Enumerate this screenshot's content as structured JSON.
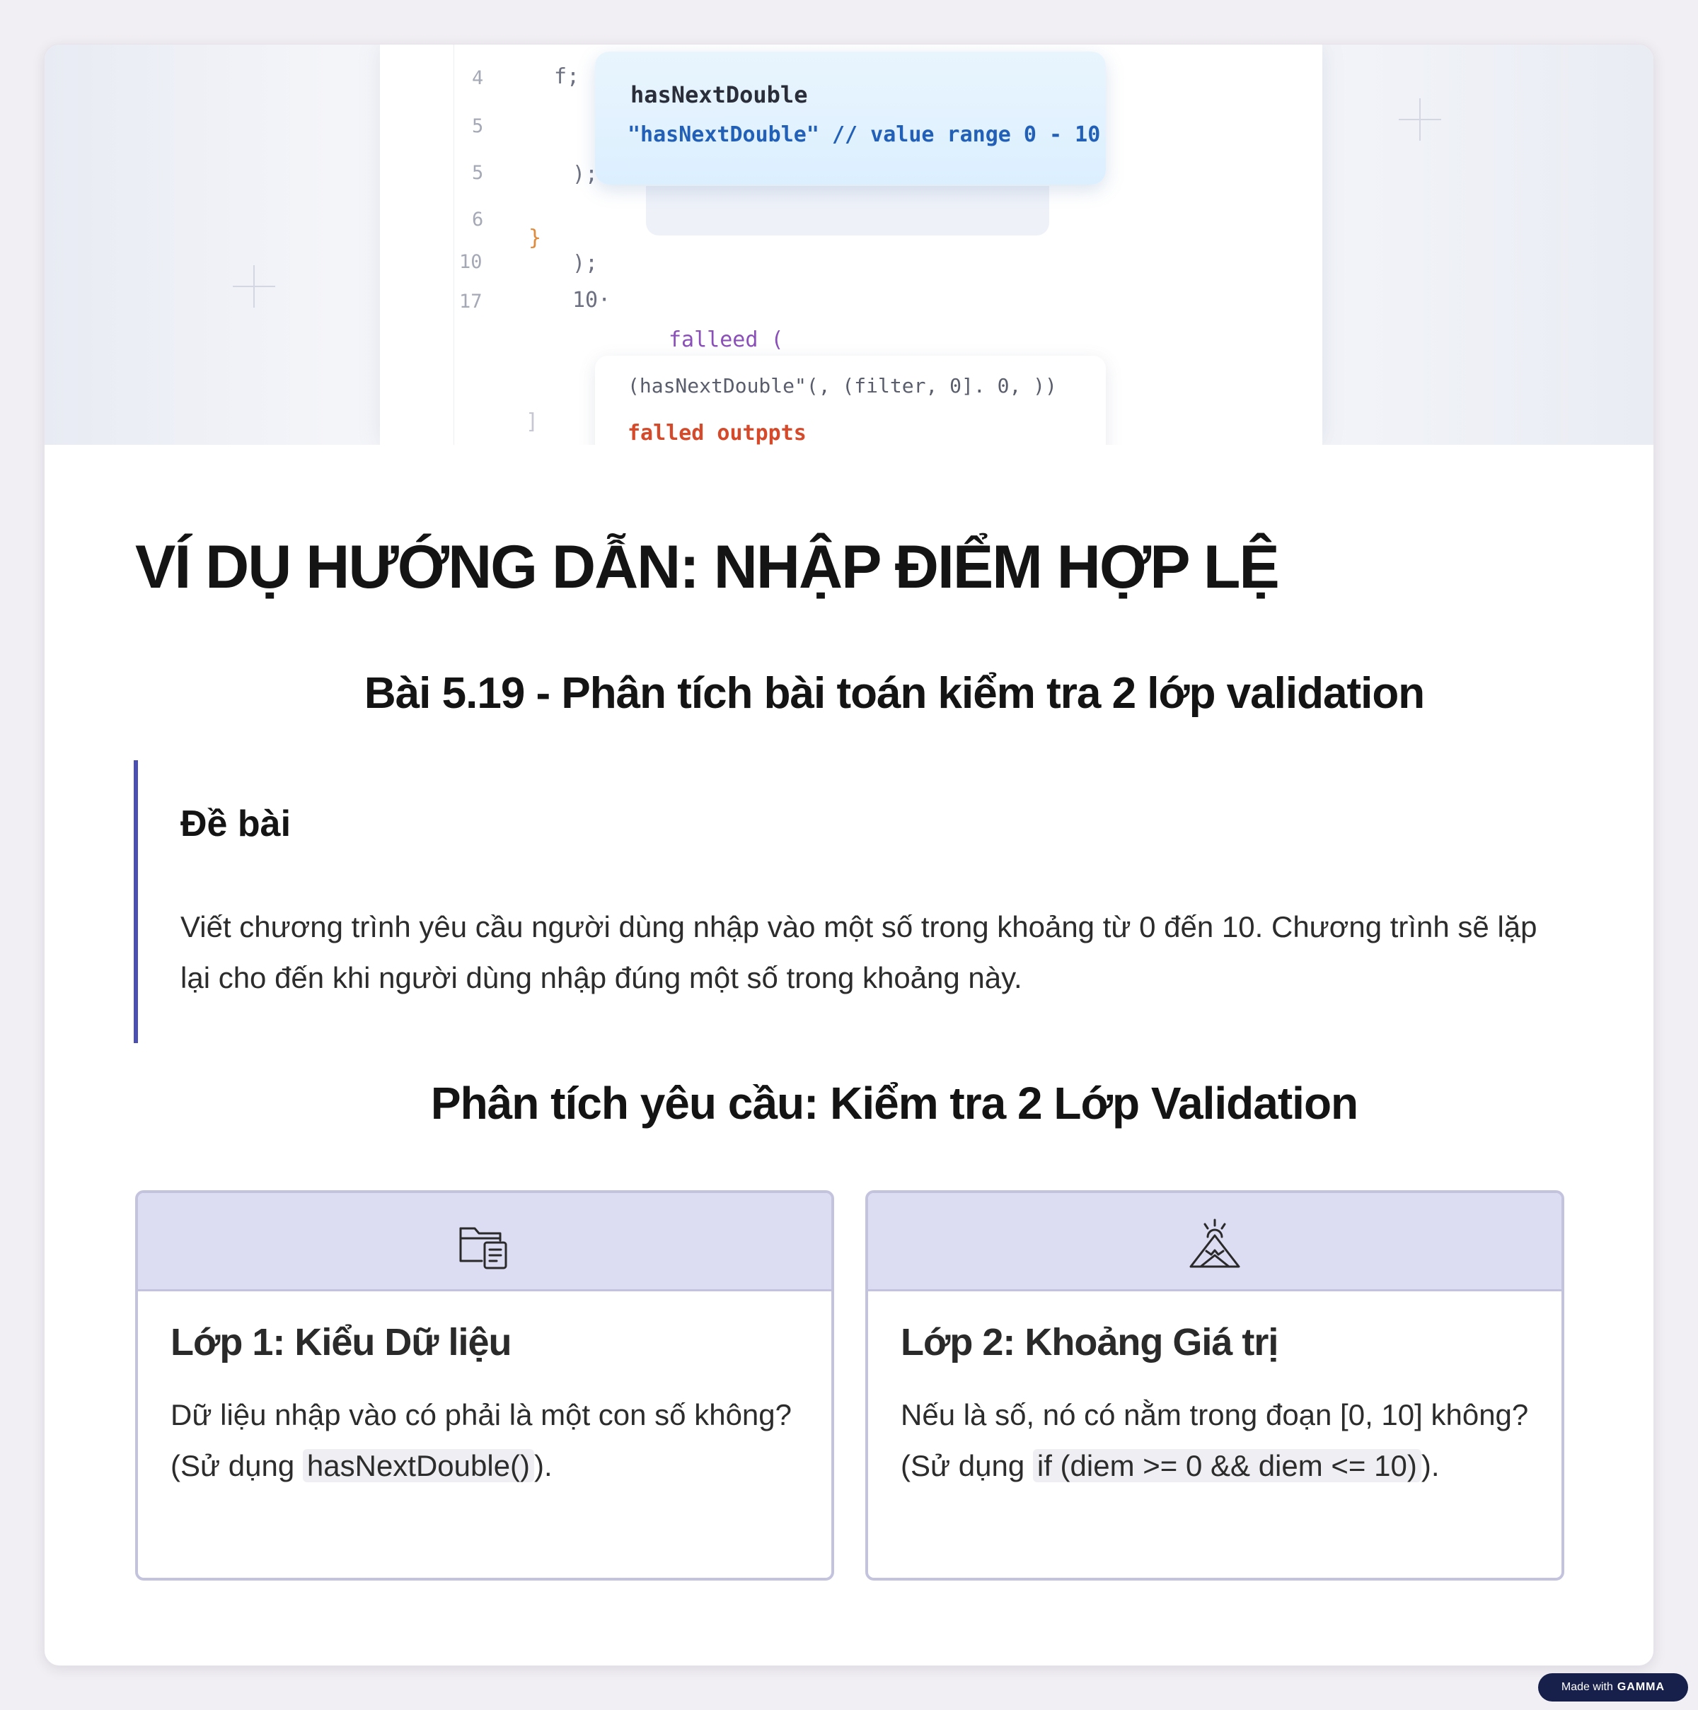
{
  "hero": {
    "line_numbers": [
      "4",
      "5",
      "5",
      "6",
      "10",
      "17"
    ],
    "code_lines": [
      "f;",
      ");",
      "}",
      ");",
      "10·",
      "falleed (",
      "(hasNextDouble\"(, (filter, 0]. 0, ))",
      "falled outppts",
      "]"
    ],
    "popup_title": "hasNextDouble",
    "popup_line_prefix": "\"hasNextDouble\"",
    "popup_line_comment": " // value range 0 - 10"
  },
  "title": "VÍ DỤ HƯỚNG DẪN: NHẬP ĐIỂM HỢP LỆ",
  "subtitle": "Bài 5.19 - Phân tích bài toán kiểm tra 2 lớp validation",
  "problem": {
    "heading": "Đề bài",
    "text": "Viết chương trình yêu cầu người dùng nhập vào một số trong khoảng từ 0 đến 10. Chương trình sẽ lặp lại cho đến khi người dùng nhập đúng một số trong khoảng này."
  },
  "analysis_title": "Phân tích yêu cầu: Kiểm tra 2 Lớp Validation",
  "layers": [
    {
      "icon": "folder-document-icon",
      "title": "Lớp 1: Kiểu Dữ liệu",
      "text_before": "Dữ liệu nhập vào có phải là một con số không? (Sử dụng ",
      "code": "hasNextDouble()",
      "text_after": ")."
    },
    {
      "icon": "mountain-sunrise-icon",
      "title": "Lớp 2: Khoảng Giá trị",
      "text_before": "Nếu là số, nó có nằm trong đoạn [0, 10] không? (Sử dụng ",
      "code": "if (diem >= 0 && diem <= 10)",
      "text_after": ")."
    }
  ],
  "badge": {
    "prefix": "Made with",
    "brand": "GAMMA"
  },
  "colors": {
    "accent": "#4b4fb4",
    "card_header": "#dcdcf3",
    "card_border": "#c4c3de"
  }
}
